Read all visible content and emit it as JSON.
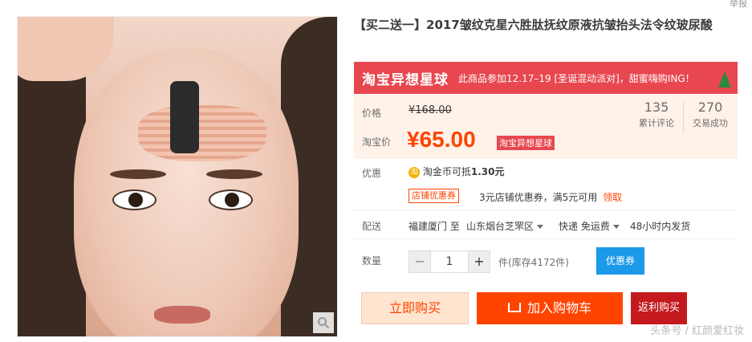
{
  "report_link": "举报",
  "title": "【买二送一】2017皱纹克星六胜肽抚纹原液抗皱抬头法令纹玻尿酸",
  "banner": {
    "logo": "淘宝异想星球",
    "text": "此商品参加12.17–19 [圣诞混动派对]，甜蜜嗨购ING！"
  },
  "price": {
    "label": "价格",
    "original": "¥168.00",
    "taobao_label": "淘宝价",
    "current": "¥65.00",
    "badge": "淘宝异想星球"
  },
  "stats": [
    {
      "num": "135",
      "cap": "累计评论"
    },
    {
      "num": "270",
      "cap": "交易成功"
    }
  ],
  "promo": {
    "label": "优惠",
    "coin_icon": "淘",
    "coin_text_prefix": "淘金币可抵",
    "coin_amount": "1.30元",
    "shop_coupon_tag": "店铺优惠券",
    "shop_coupon_text": "3元店铺优惠券，满5元可用",
    "claim_link": "领取"
  },
  "delivery": {
    "label": "配送",
    "from": "福建厦门 至",
    "to": "山东烟台芝罘区",
    "method": "快递 免运费",
    "ship_time": "48小时内发货"
  },
  "quantity": {
    "label": "数量",
    "minus": "−",
    "value": "1",
    "plus": "+",
    "stock": "件(库存4172件)",
    "coupon_button": "优惠券"
  },
  "actions": {
    "buy_now": "立即购买",
    "add_to_cart": "加入购物车",
    "rebate": "返利购买"
  },
  "watermark": "头条号 / 红颜爱红妆",
  "colors": {
    "accent": "#ff4400",
    "banner": "#e8474f",
    "price_bg": "#fff2e8",
    "coupon_blue": "#1a9ae8",
    "rebate_red": "#c4191e"
  }
}
